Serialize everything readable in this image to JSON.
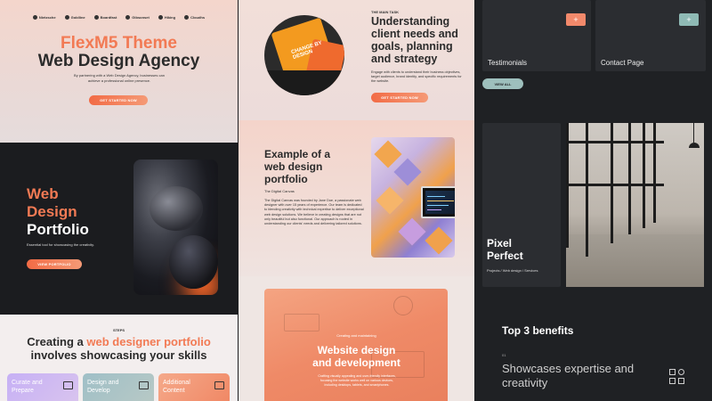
{
  "col1": {
    "logos": [
      "Nietzsche",
      "Goldline",
      "Boardfast",
      "Gibsonset",
      "Hiking",
      "Cloudhs"
    ],
    "hero_title_accent": "FlexM5 Theme",
    "hero_title": "Web Design Agency",
    "hero_sub": "By partnering with a Web Design Agency, businesses can achieve a professional online presence.",
    "hero_button": "GET STARTED NOW",
    "portfolio_title": [
      "Web",
      "Design",
      "Portfolio"
    ],
    "portfolio_sub": "Essential tool for showcasing the creativity.",
    "portfolio_button": "VIEW PORTFOLIO",
    "steps_label": "STEPS",
    "steps_title_a": "Creating a ",
    "steps_title_accent": "web designer portfolio",
    "steps_title_b": "involves showcasing your skills",
    "cards": [
      "Curate and Prepare",
      "Design and Develop",
      "Additional Content"
    ]
  },
  "col2": {
    "circle_text": "CHANGE BY DESIGN",
    "main_label": "THE MAIN TASK",
    "main_title": "Understanding client needs and goals, planning and strategy",
    "main_text": "Engage with clients to understand their business objectives, target audience, brand identity, and specific requirements for the website.",
    "main_button": "GET STARTED NOW",
    "example_title": "Example of a web design portfolio",
    "example_sub": "The Digital Canvas",
    "example_text": "The Digital Canvas was founded by Jane Doe, a passionate web designer with over 15 years of experience. Our team is dedicated to blending creativity with technical expertise to deliver exceptional web design solutions. We believe in creating designs that are not only beautiful but also functional. Our approach is rooted in understanding our clients' needs and delivering tailored solutions.",
    "laptop_label": "Creating and maintaining",
    "laptop_title": "Website design and development",
    "laptop_text": "Crafting visually appealing and user-friendly interfaces, focusing the website works well on various devices, including desktops, tablets, and smartphones."
  },
  "col3": {
    "tile_a": "Testimonials",
    "tile_b": "Contact Page",
    "plus": "+",
    "view_all": "VIEW ALL",
    "pp_title": "Pixel Perfect",
    "pp_sub": "Projects / Web design / Services",
    "benefits_title": "Top 3 benefits",
    "benefit_num": "01",
    "benefit_text": "Showcases expertise and creativity"
  }
}
